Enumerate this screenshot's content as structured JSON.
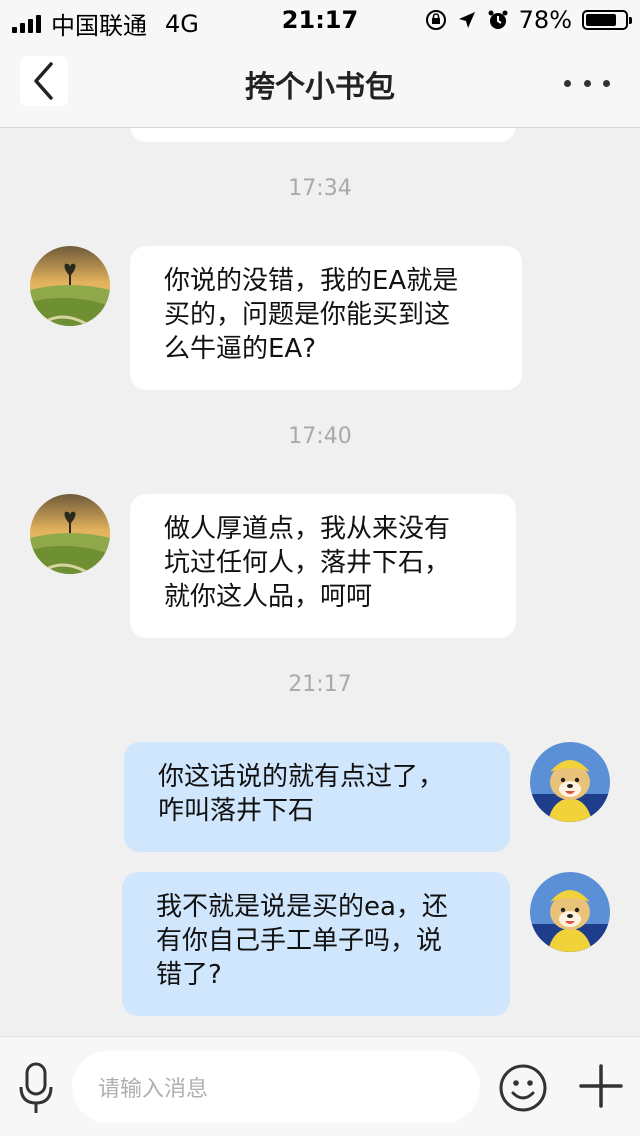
{
  "status_bar": {
    "carrier": "中国联通",
    "network": "4G",
    "time": "21:17",
    "battery_percent": "78%",
    "battery_level": 0.78
  },
  "nav": {
    "title": "挎个小书包",
    "back_icon": "chevron-left-icon",
    "more_icon": "more-dots-icon"
  },
  "chat": {
    "top_bubble_partial": "",
    "timestamps": [
      "17:34",
      "17:40",
      "21:17"
    ],
    "messages": [
      {
        "side": "in",
        "text": "你说的没错，我的EA就是\n买的，问题是你能买到这\n么牛逼的EA?"
      },
      {
        "side": "in",
        "text": "做人厚道点，我从来没有\n坑过任何人，落井下石，\n就你这人品，呵呵"
      },
      {
        "side": "out",
        "text": "你这话说的就有点过了，\n咋叫落井下石"
      },
      {
        "side": "out",
        "text": "我不就是说是买的ea，还\n有你自己手工单子吗，说\n错了?"
      }
    ]
  },
  "input_bar": {
    "placeholder": "请输入消息",
    "icons": [
      "microphone-icon",
      "emoji-icon",
      "plus-icon"
    ]
  },
  "colors": {
    "incoming_bubble": "#ffffff",
    "outgoing_bubble": "#cfe6fd",
    "background": "#f0f0f1",
    "timestamp": "#a9a9a9"
  }
}
